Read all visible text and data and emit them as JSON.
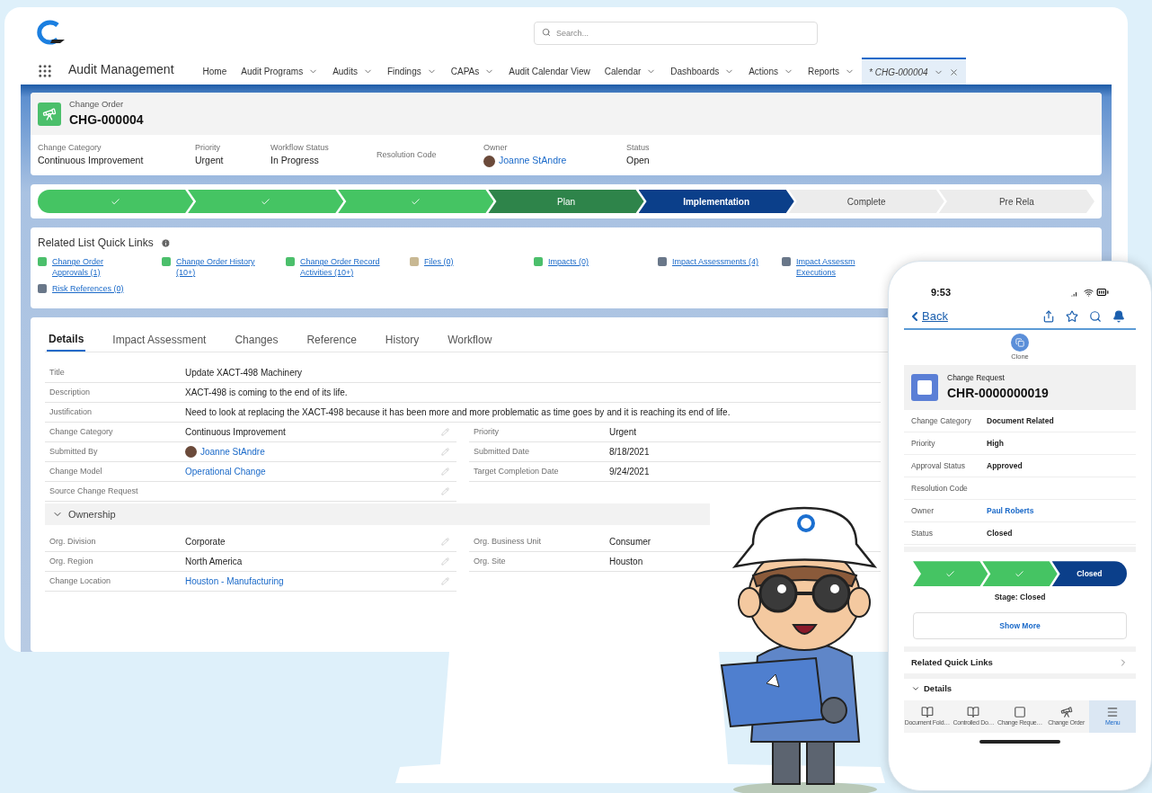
{
  "search": {
    "placeholder": "Search..."
  },
  "app_name": "Audit Management",
  "nav": [
    {
      "label": "Home",
      "dropdown": false,
      "closable": false,
      "selected": false
    },
    {
      "label": "Audit Programs",
      "dropdown": true,
      "closable": false,
      "selected": false
    },
    {
      "label": "Audits",
      "dropdown": true,
      "closable": false,
      "selected": false
    },
    {
      "label": "Findings",
      "dropdown": true,
      "closable": false,
      "selected": false
    },
    {
      "label": "CAPAs",
      "dropdown": true,
      "closable": false,
      "selected": false
    },
    {
      "label": "Audit Calendar View",
      "dropdown": false,
      "closable": false,
      "selected": false
    },
    {
      "label": "Calendar",
      "dropdown": true,
      "closable": false,
      "selected": false
    },
    {
      "label": "Dashboards",
      "dropdown": true,
      "closable": false,
      "selected": false
    },
    {
      "label": "Actions",
      "dropdown": true,
      "closable": false,
      "selected": false
    },
    {
      "label": "Reports",
      "dropdown": true,
      "closable": false,
      "selected": false
    },
    {
      "label": "* CHG-000004",
      "dropdown": true,
      "closable": true,
      "selected": true
    }
  ],
  "record": {
    "type_label": "Change Order",
    "name": "CHG-000004",
    "fields": [
      {
        "label": "Change Category",
        "value": "Continuous Improvement",
        "kind": "text"
      },
      {
        "label": "Priority",
        "value": "Urgent",
        "kind": "text"
      },
      {
        "label": "Workflow Status",
        "value": "In Progress",
        "kind": "text"
      },
      {
        "label": "Resolution Code",
        "kind": "text"
      },
      {
        "label": "Owner",
        "value": "Joanne StAndre",
        "kind": "user"
      },
      {
        "label": "Status",
        "value": "Open",
        "kind": "text"
      }
    ]
  },
  "path": [
    {
      "kind": "done"
    },
    {
      "kind": "done"
    },
    {
      "kind": "done"
    },
    {
      "label": "Plan",
      "kind": "current"
    },
    {
      "label": "Implementation",
      "kind": "selected"
    },
    {
      "label": "Complete",
      "kind": "upcoming"
    },
    {
      "label": "Pre Rela",
      "kind": "upcoming"
    }
  ],
  "quick_links": {
    "title": "Related List Quick Links",
    "items": [
      {
        "label": "Change Order Approvals (1)",
        "color": "#4bbf6b"
      },
      {
        "label": "Change Order History (10+)",
        "color": "#4bbf6b"
      },
      {
        "label": "Change Order Record Activities (10+)",
        "color": "#4bbf6b"
      },
      {
        "label": "Files (0)",
        "color": "#c8b893"
      },
      {
        "label": "Impacts (0)",
        "color": "#4bbf6b"
      },
      {
        "label": "Impact Assessments (4)",
        "color": "#697789"
      },
      {
        "label": "Impact Assessm Executions",
        "color": "#697789"
      },
      {
        "label": "Risk References (0)",
        "color": "#697789"
      }
    ]
  },
  "tabs": [
    {
      "label": "Details",
      "selected": true
    },
    {
      "label": "Impact Assessment",
      "selected": false
    },
    {
      "label": "Changes",
      "selected": false
    },
    {
      "label": "Reference",
      "selected": false
    },
    {
      "label": "History",
      "selected": false
    },
    {
      "label": "Workflow",
      "selected": false
    }
  ],
  "details": {
    "rows": [
      {
        "kind": "wide",
        "cells": [
          {
            "label": "Title",
            "value": "Update XACT-498 Machinery",
            "kind": "text",
            "editable": false
          }
        ]
      },
      {
        "kind": "wide",
        "cells": [
          {
            "label": "Description",
            "value": "XACT-498 is coming to the end of its life.",
            "kind": "text",
            "editable": false
          }
        ]
      },
      {
        "kind": "wide",
        "cells": [
          {
            "label": "Justification",
            "value": "Need to look at replacing the XACT-498 because it has been more and more problematic as time goes by and it is reaching its end of life.",
            "kind": "text",
            "editable": false
          }
        ]
      },
      {
        "kind": "pair",
        "cells": [
          {
            "label": "Change Category",
            "value": "Continuous Improvement",
            "kind": "text",
            "editable": true
          },
          {
            "label": "Priority",
            "value": "Urgent",
            "kind": "text",
            "editable": false
          }
        ]
      },
      {
        "kind": "pair",
        "cells": [
          {
            "label": "Submitted By",
            "value": "Joanne StAndre",
            "kind": "user",
            "editable": true
          },
          {
            "label": "Submitted Date",
            "value": "8/18/2021",
            "kind": "text",
            "editable": false
          }
        ]
      },
      {
        "kind": "pair",
        "cells": [
          {
            "label": "Change Model",
            "value": "Operational Change",
            "kind": "link",
            "editable": true
          },
          {
            "label": "Target Completion Date",
            "value": "9/24/2021",
            "kind": "text",
            "editable": false
          }
        ]
      },
      {
        "kind": "pair",
        "cells": [
          {
            "label": "Source Change Request",
            "kind": "text",
            "editable": true
          }
        ]
      }
    ],
    "section": {
      "title": "Ownership",
      "expanded": true,
      "rows": [
        {
          "kind": "pair",
          "cells": [
            {
              "label": "Org. Division",
              "value": "Corporate",
              "kind": "text",
              "editable": true
            },
            {
              "label": "Org. Business Unit",
              "value": "Consumer",
              "kind": "text",
              "editable": false
            }
          ]
        },
        {
          "kind": "pair",
          "cells": [
            {
              "label": "Org. Region",
              "value": "North America",
              "kind": "text",
              "editable": true
            },
            {
              "label": "Org. Site",
              "value": "Houston",
              "kind": "text",
              "editable": false
            }
          ]
        },
        {
          "kind": "pair",
          "cells": [
            {
              "label": "Change Location",
              "value": "Houston - Manufacturing",
              "kind": "link",
              "editable": true
            }
          ]
        }
      ]
    }
  },
  "phone": {
    "time": "9:53",
    "back": "Back",
    "action": "Clone",
    "record_type": "Change Request",
    "record_name": "CHR-0000000019",
    "fields": [
      {
        "label": "Change Category",
        "value": "Document Related",
        "kind": "text"
      },
      {
        "label": "Priority",
        "value": "High",
        "kind": "text"
      },
      {
        "label": "Approval Status",
        "value": "Approved",
        "kind": "text"
      },
      {
        "label": "Resolution Code",
        "kind": "text"
      },
      {
        "label": "Owner",
        "value": "Paul Roberts",
        "kind": "link"
      },
      {
        "label": "Status",
        "value": "Closed",
        "kind": "text"
      }
    ],
    "path": [
      {
        "kind": "done"
      },
      {
        "kind": "done"
      },
      {
        "label": "Closed",
        "kind": "selected"
      }
    ],
    "stage": "Stage: Closed",
    "show_more": "Show More",
    "sections": [
      {
        "title": "Related Quick Links",
        "kind": "link"
      },
      {
        "title": "Details",
        "kind": "collapsible",
        "expanded": true
      }
    ],
    "tabbar": [
      {
        "label": "Document Fold…",
        "kind": "book",
        "selected": false
      },
      {
        "label": "Controlled Do…",
        "kind": "book",
        "selected": false
      },
      {
        "label": "Change Reque…",
        "kind": "square",
        "selected": false
      },
      {
        "label": "Change Order",
        "kind": "telescope",
        "selected": false
      },
      {
        "label": "Menu",
        "kind": "menu",
        "selected": true
      }
    ]
  }
}
